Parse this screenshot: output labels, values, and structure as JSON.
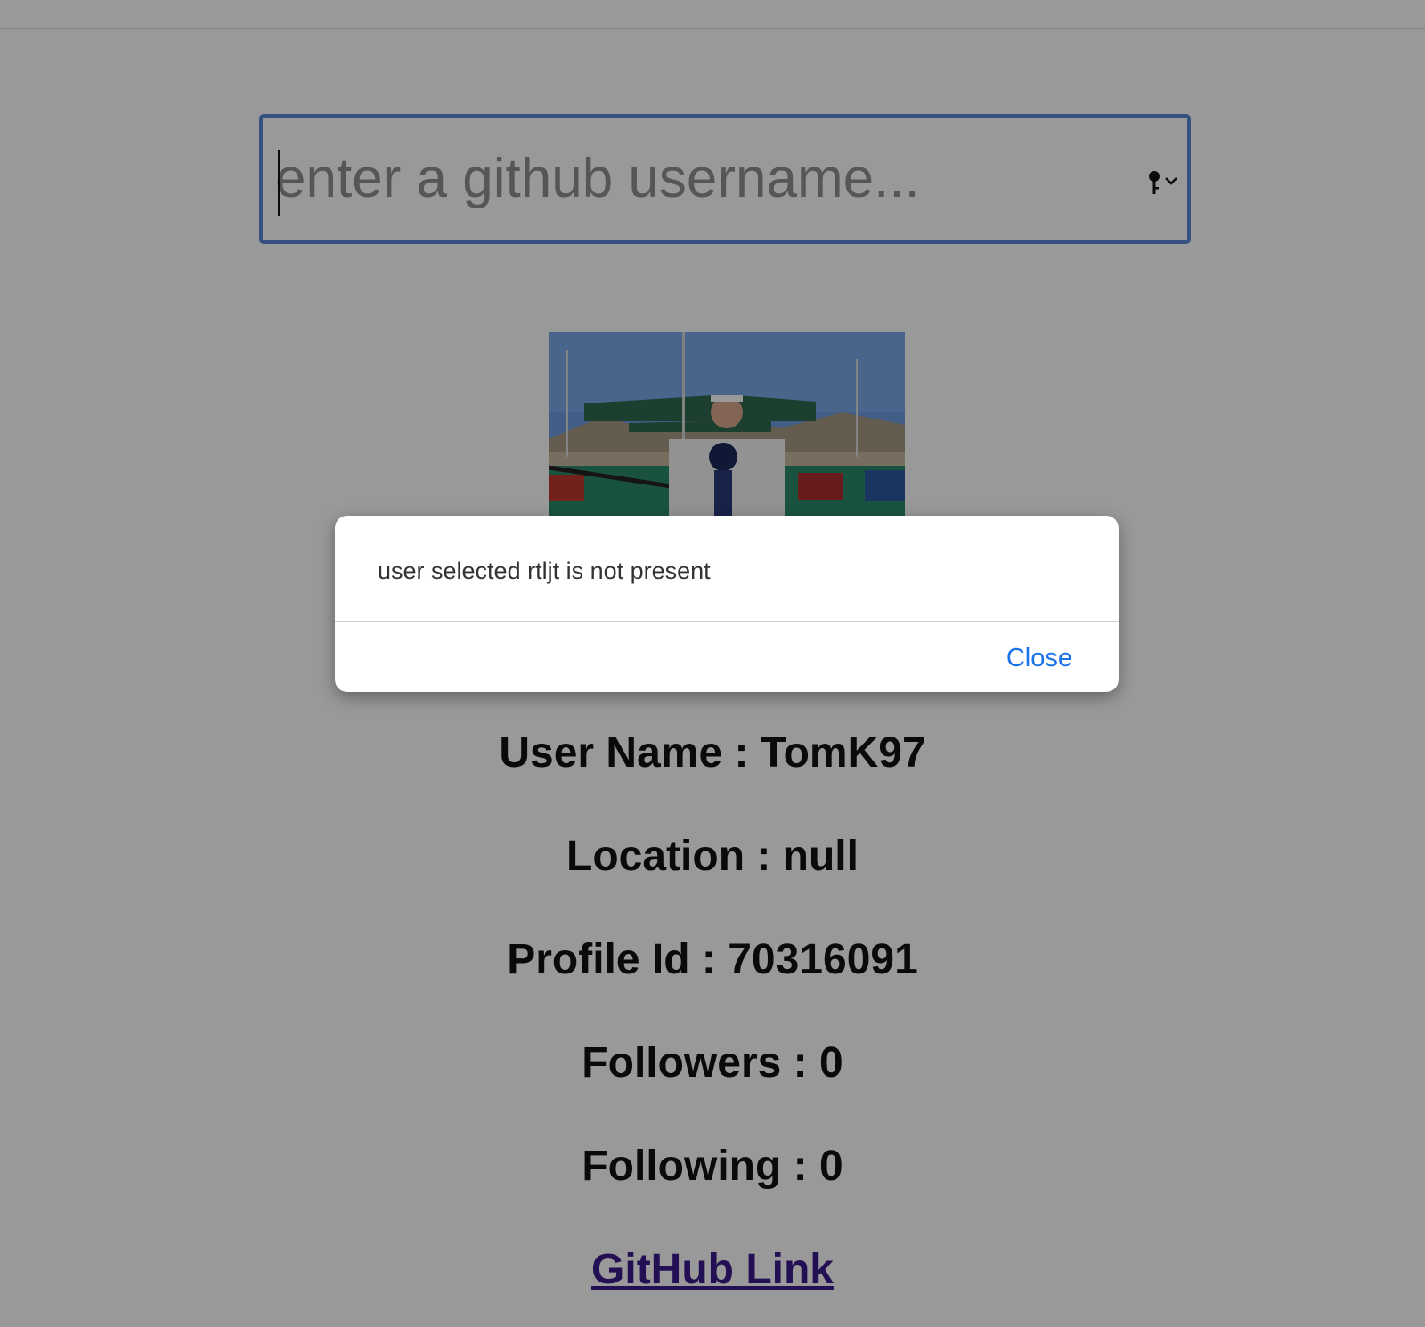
{
  "search": {
    "placeholder": "enter a github username...",
    "value": ""
  },
  "profile": {
    "avatar_icon": "profile-photo",
    "lines": [
      "User Name : TomK97",
      "Location : null",
      "Profile Id : 70316091",
      "Followers : 0",
      "Following : 0"
    ],
    "link_label": "GitHub Link"
  },
  "dialog": {
    "message": "user selected rtljt is not present",
    "close_label": "Close"
  },
  "colors": {
    "search_border": "#5b86d6",
    "link": "#3a1a8c",
    "close_button": "#1a73e8"
  }
}
